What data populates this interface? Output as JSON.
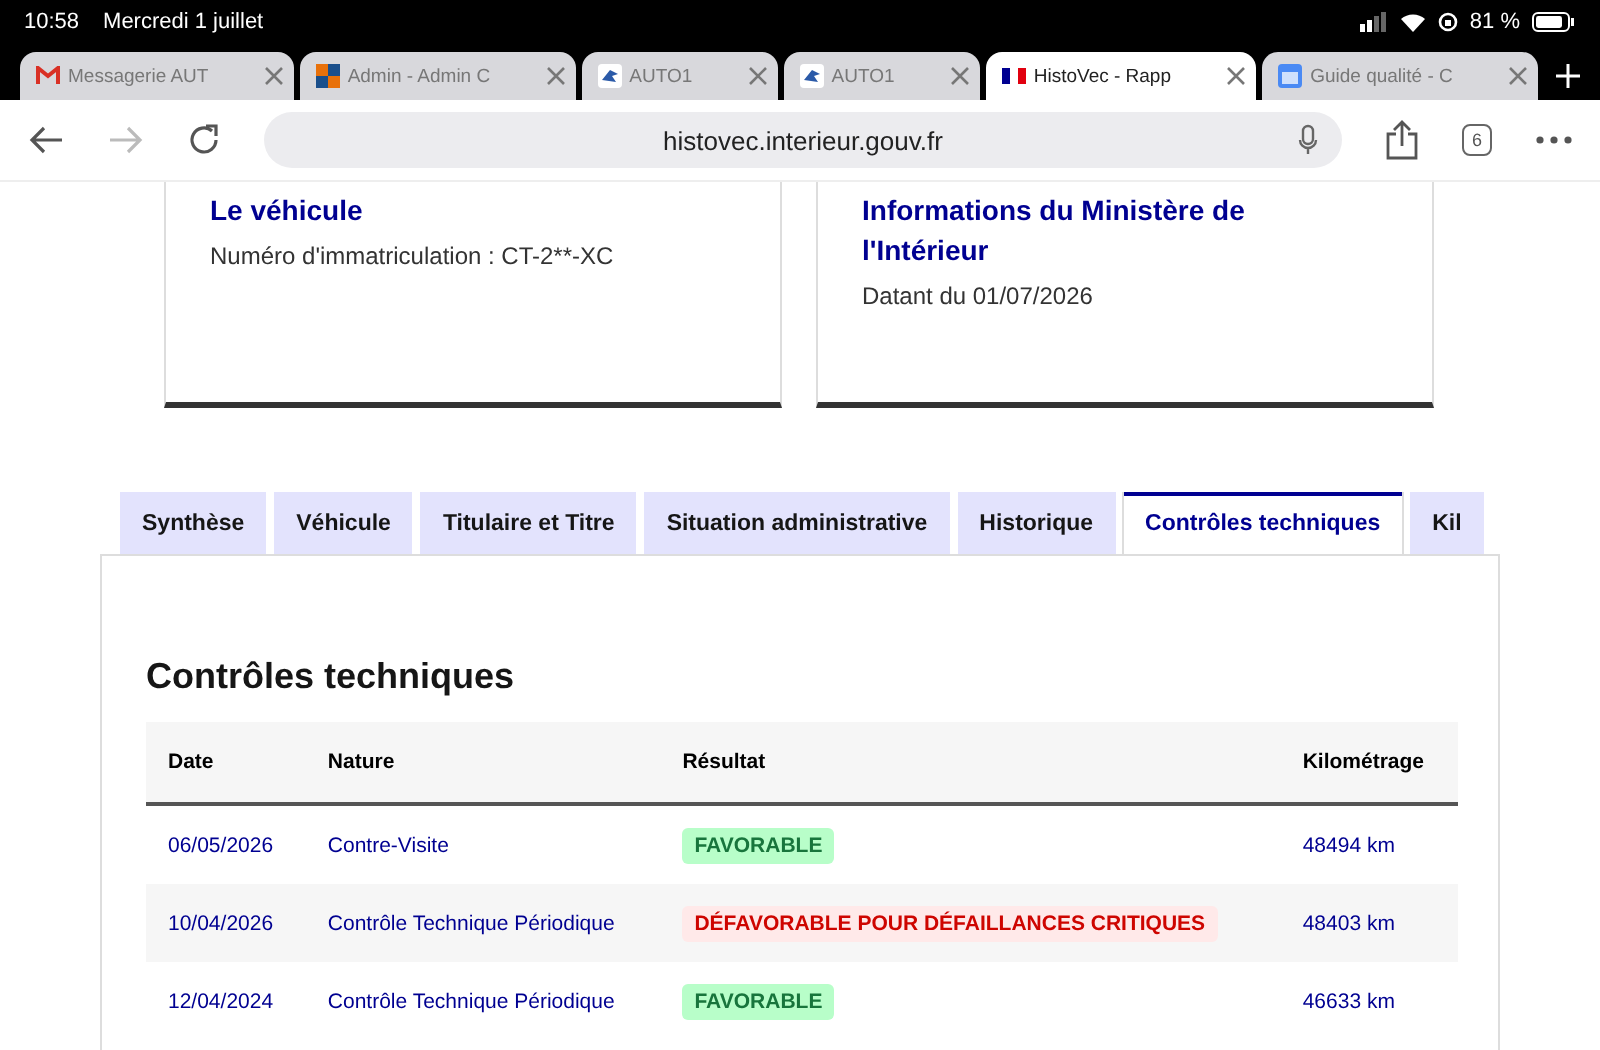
{
  "status_bar": {
    "time": "10:58",
    "date": "Mercredi 1 juillet",
    "battery": "81 %"
  },
  "browser_tabs": [
    {
      "title": "Messagerie AUT",
      "selected": false
    },
    {
      "title": "Admin - Admin C",
      "selected": false
    },
    {
      "title": "AUTO1",
      "selected": false
    },
    {
      "title": "AUTO1",
      "selected": false
    },
    {
      "title": "HistoVec - Rapp",
      "selected": true
    },
    {
      "title": "Guide qualité - C",
      "selected": false
    }
  ],
  "toolbar": {
    "url": "histovec.interieur.gouv.fr",
    "tab_count": "6"
  },
  "cards": [
    {
      "title": "Le véhicule",
      "text": "Numéro d'immatriculation : CT-2**-XC"
    },
    {
      "title": "Informations du Ministère de l'Intérieur",
      "text": "Datant du 01/07/2026"
    }
  ],
  "tabs": [
    {
      "label": "Synthèse",
      "selected": false
    },
    {
      "label": "Véhicule",
      "selected": false
    },
    {
      "label": "Titulaire et Titre",
      "selected": false
    },
    {
      "label": "Situation administrative",
      "selected": false
    },
    {
      "label": "Historique",
      "selected": false
    },
    {
      "label": "Contrôles techniques",
      "selected": true
    },
    {
      "label": "Kil",
      "selected": false
    }
  ],
  "section_title": "Contrôles techniques",
  "table": {
    "columns": [
      "Date",
      "Nature",
      "Résultat",
      "Kilométrage"
    ],
    "rows": [
      {
        "date": "06/05/2026",
        "nature": "Contre-Visite",
        "result": "FAVORABLE",
        "kind": "ok",
        "km": "48494 km"
      },
      {
        "date": "10/04/2026",
        "nature": "Contrôle Technique Périodique",
        "result": "DÉFAVORABLE POUR DÉFAILLANCES CRITIQUES",
        "kind": "ko",
        "km": "48403 km"
      },
      {
        "date": "12/04/2024",
        "nature": "Contrôle Technique Périodique",
        "result": "FAVORABLE",
        "kind": "ok",
        "km": "46633 km"
      }
    ]
  }
}
